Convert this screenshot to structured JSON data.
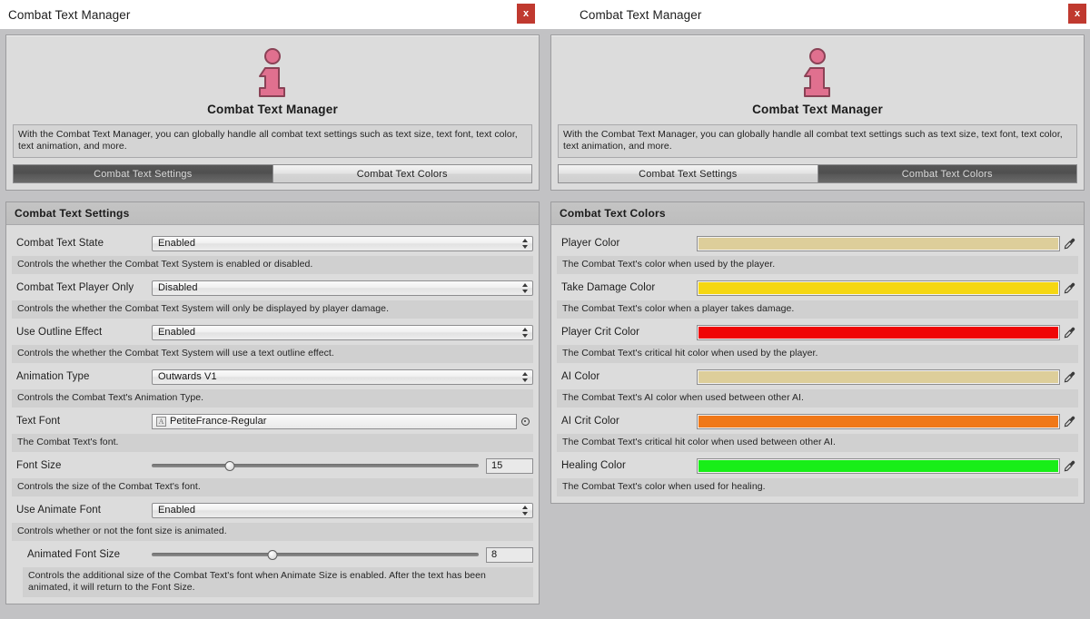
{
  "window": {
    "left_title": "Combat Text Manager",
    "right_title": "Combat Text Manager",
    "close_label": "x",
    "accent_close": "#c0392f"
  },
  "header": {
    "title": "Combat Text Manager",
    "description": "With the Combat Text Manager, you can globally handle all combat text settings such as text size, text font, text color, text animation, and more.",
    "icon": "info-icon",
    "icon_color": "#e0708f",
    "tabs": [
      {
        "label": "Combat Text Settings"
      },
      {
        "label": "Combat Text Colors"
      }
    ]
  },
  "settings_panel": {
    "section_title": "Combat Text Settings",
    "active_tab": 0,
    "rows": [
      {
        "label": "Combat Text State",
        "type": "dropdown",
        "value": "Enabled",
        "help": "Controls the whether the Combat Text System is enabled or disabled."
      },
      {
        "label": "Combat Text Player Only",
        "type": "dropdown",
        "value": "Disabled",
        "help": "Controls the whether the Combat Text System will only be displayed by player damage."
      },
      {
        "label": "Use Outline Effect",
        "type": "dropdown",
        "value": "Enabled",
        "help": "Controls the whether the Combat Text System will use a text outline effect."
      },
      {
        "label": "Animation Type",
        "type": "dropdown",
        "value": "Outwards V1",
        "help": "Controls the Combat Text's Animation Type."
      },
      {
        "label": "Text Font",
        "type": "object",
        "value": "PetiteFrance-Regular",
        "help": "The Combat Text's font."
      },
      {
        "label": "Font Size",
        "type": "slider",
        "value": "15",
        "percent": 24,
        "help": "Controls the size of the Combat Text's font."
      },
      {
        "label": "Use Animate Font",
        "type": "dropdown",
        "value": "Enabled",
        "help": "Controls whether or not the font size is animated."
      },
      {
        "label": "Animated Font Size",
        "type": "slider",
        "value": "8",
        "percent": 37,
        "indent": true,
        "help": "Controls the additional size of the Combat Text's font when Animate Size is enabled. After the text has been animated, it will return to the Font Size."
      }
    ]
  },
  "colors_panel": {
    "section_title": "Combat Text Colors",
    "active_tab": 1,
    "rows": [
      {
        "label": "Player Color",
        "color": "#ddce9a",
        "help": "The Combat Text's color when used by the player."
      },
      {
        "label": "Take Damage Color",
        "color": "#f5d712",
        "help": "The Combat Text's color when a player takes damage."
      },
      {
        "label": "Player Crit Color",
        "color": "#ef0606",
        "help": "The Combat Text's critical hit color when used by the player."
      },
      {
        "label": "AI Color",
        "color": "#ddce9a",
        "help": "The Combat Text's AI color when used between other AI."
      },
      {
        "label": "AI Crit Color",
        "color": "#f07818",
        "help": "The Combat Text's critical hit color when used between other AI."
      },
      {
        "label": "Healing Color",
        "color": "#18ee18",
        "help": "The Combat Text's color when used for healing."
      }
    ]
  }
}
